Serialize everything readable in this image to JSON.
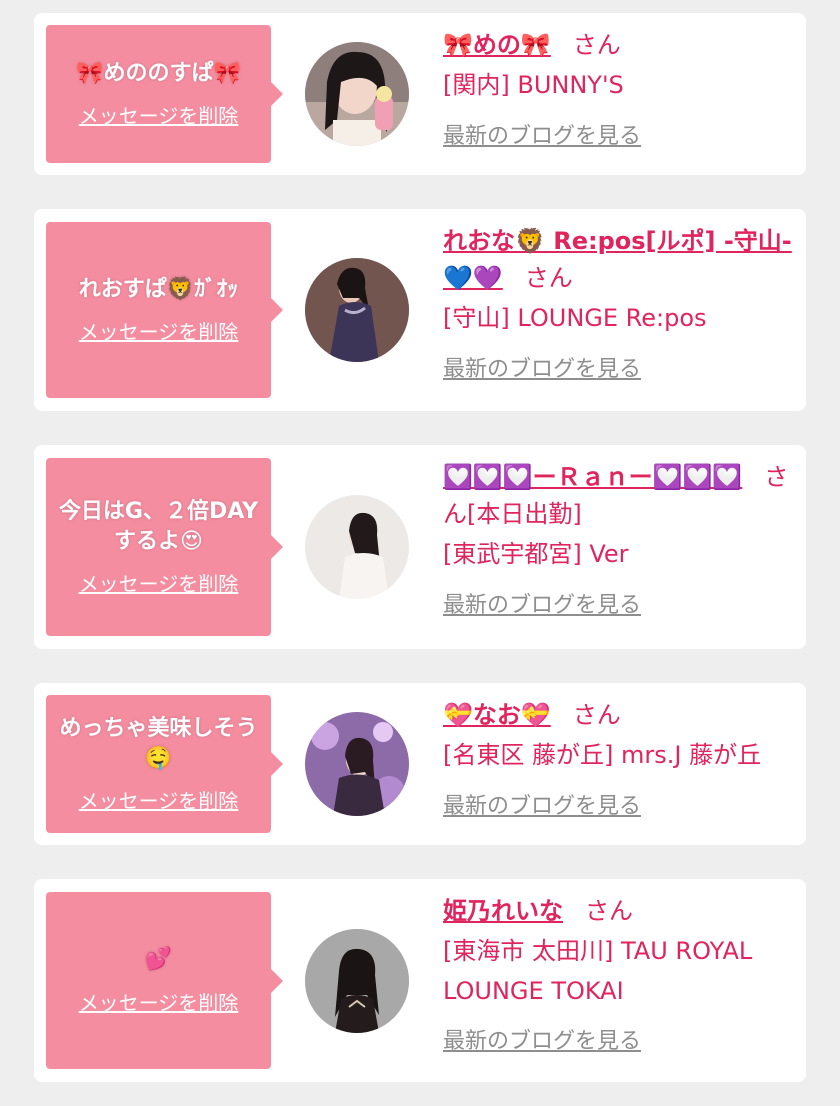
{
  "cards": [
    {
      "message": "🎀めののすぱ🎀",
      "delete_label": "メッセージを削除",
      "name": "🎀めの🎀",
      "honorific": "さん",
      "status": "",
      "shop": "[関内] BUNNY'S",
      "blog_link": "最新のブログを見る"
    },
    {
      "message": "れおすぱ🦁ｶﾞｵｯ",
      "delete_label": "メッセージを削除",
      "name": "れおな🦁 Re:pos[ルポ] -守山-💙💜",
      "honorific": "さん",
      "status": "",
      "shop": "[守山] LOUNGE Re:pos",
      "blog_link": "最新のブログを見る"
    },
    {
      "message": "今日はG、２倍DAYするよ😍",
      "delete_label": "メッセージを削除",
      "name": "💟💟💟ーＲａｎー💟💟💟",
      "honorific": "さん",
      "status": "[本日出勤]",
      "shop": "[東武宇都宮] Ver",
      "blog_link": "最新のブログを見る"
    },
    {
      "message": "めっちゃ美味しそう🤤",
      "delete_label": "メッセージを削除",
      "name": "💝なお💝",
      "honorific": "さん",
      "status": "",
      "shop": "[名東区 藤が丘] mrs.J 藤が丘",
      "blog_link": "最新のブログを見る"
    },
    {
      "message": "💕",
      "delete_label": "メッセージを削除",
      "name": "姫乃れいな",
      "honorific": "さん",
      "status": "",
      "shop": "[東海市 太田川] TAU ROYAL LOUNGE TOKAI",
      "blog_link": "最新のブログを見る"
    }
  ],
  "colors": {
    "page_background": "#eeeeee",
    "card_background": "#ffffff",
    "bubble": "#f58da0",
    "accent_text": "#e0245e",
    "link_gray": "#8e8e8e"
  }
}
